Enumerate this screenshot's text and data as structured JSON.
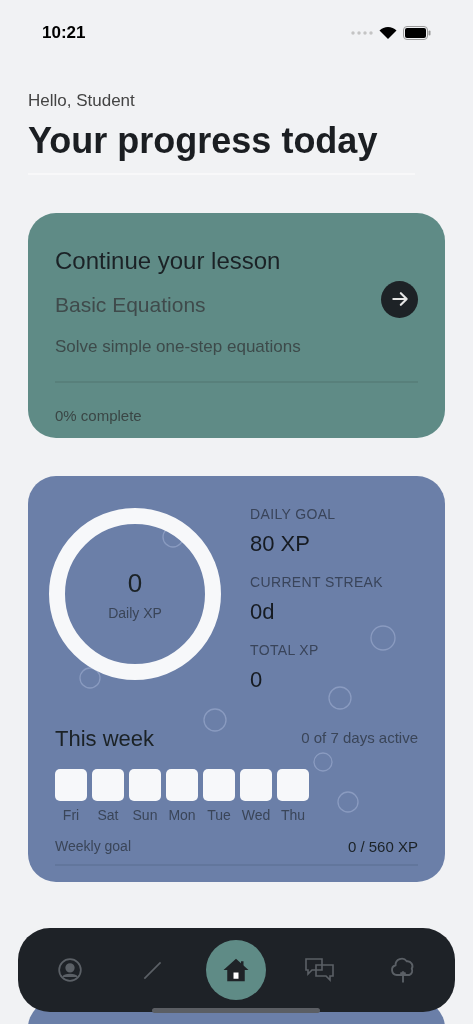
{
  "status_bar": {
    "time": "10:21"
  },
  "greeting": "Hello, Student",
  "title": "Your progress today",
  "lesson_card": {
    "heading": "Continue your lesson",
    "lesson": "Basic Equations",
    "description": "Solve simple one-step equations",
    "level": 0,
    "progress_label": "0% complete"
  },
  "stats_card": {
    "ring": {
      "value": "0",
      "label": "Daily XP"
    },
    "stats": [
      {
        "label": "DAILY GOAL",
        "value": "80 XP"
      },
      {
        "label": "CURRENT STREAK",
        "value": "0d"
      },
      {
        "label": "TOTAL XP",
        "value": "0"
      }
    ],
    "week": {
      "title": "This week",
      "summary": "0 of 7 days active",
      "days": [
        {
          "label": "Fri",
          "active": false
        },
        {
          "label": "Sat",
          "active": false
        },
        {
          "label": "Sun",
          "active": false
        },
        {
          "label": "Mon",
          "active": false
        },
        {
          "label": "Tue",
          "active": false
        },
        {
          "label": "Wed",
          "active": false
        },
        {
          "label": "Thu",
          "active": false
        }
      ]
    },
    "weekly_goal": {
      "label": "Weekly goal",
      "value": "0 / 560 XP",
      "level": 0
    }
  },
  "nav": [
    {
      "kind": "profile",
      "selected": false
    },
    {
      "kind": "pencil",
      "selected": false
    },
    {
      "kind": "home",
      "selected": true
    },
    {
      "kind": "chat",
      "selected": false
    },
    {
      "kind": "tree",
      "selected": false
    }
  ]
}
